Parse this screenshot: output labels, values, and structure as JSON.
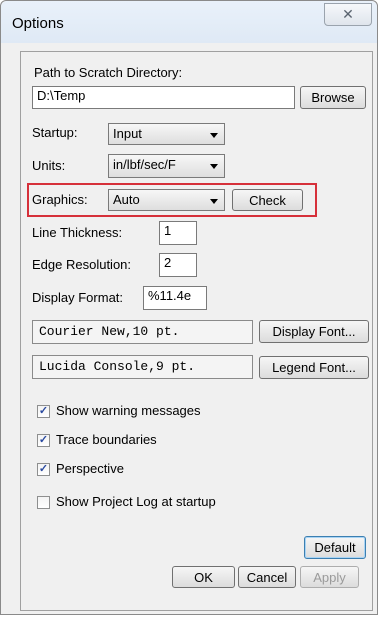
{
  "window": {
    "title": "Options",
    "close_glyph": "✕"
  },
  "scratch": {
    "label": "Path to Scratch Directory:",
    "value": "D:\\Temp",
    "browse_label": "Browse"
  },
  "startup": {
    "label": "Startup:",
    "value": "Input"
  },
  "units": {
    "label": "Units:",
    "value": "in/lbf/sec/F"
  },
  "graphics": {
    "label": "Graphics:",
    "value": "Auto",
    "check_label": "Check"
  },
  "line_thickness": {
    "label": "Line Thickness:",
    "value": "1"
  },
  "edge_resolution": {
    "label": "Edge Resolution:",
    "value": "2"
  },
  "display_format": {
    "label": "Display Format:",
    "value": "%11.4e"
  },
  "fonts": {
    "display_font_value": "Courier New,10 pt.",
    "display_font_button": "Display Font...",
    "legend_font_value": "Lucida Console,9 pt.",
    "legend_font_button": "Legend Font..."
  },
  "checkboxes": [
    {
      "label": "Show warning messages",
      "checked": true
    },
    {
      "label": "Trace boundaries",
      "checked": true
    },
    {
      "label": "Perspective",
      "checked": true
    },
    {
      "label": "Show Project Log at startup",
      "checked": false
    }
  ],
  "buttons": {
    "default": "Default",
    "ok": "OK",
    "cancel": "Cancel",
    "apply": "Apply"
  },
  "colors": {
    "highlight_border": "#d6303a",
    "checkmark": "#2a4aa0"
  }
}
